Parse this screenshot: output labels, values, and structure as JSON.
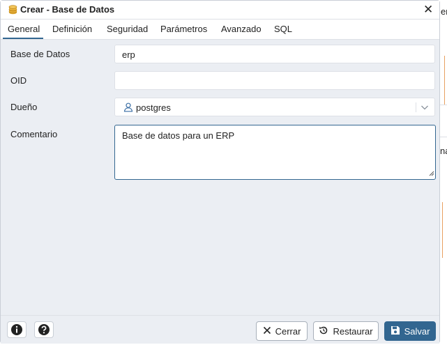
{
  "background": {
    "partial_text_top": "er",
    "partial_text_mid": "na"
  },
  "dialog": {
    "title": "Crear - Base de Datos",
    "icons": {
      "title": "database-icon",
      "close": "close-icon"
    }
  },
  "tabs": [
    {
      "label": "General",
      "active": true
    },
    {
      "label": "Definición"
    },
    {
      "label": "Seguridad"
    },
    {
      "label": "Parámetros"
    },
    {
      "label": "Avanzado"
    },
    {
      "label": "SQL"
    }
  ],
  "form": {
    "database": {
      "label": "Base de Datos",
      "value": "erp"
    },
    "oid": {
      "label": "OID",
      "value": ""
    },
    "owner": {
      "label": "Dueño",
      "value": "postgres",
      "icon": "user-icon"
    },
    "comment": {
      "label": "Comentario",
      "value": "Base de datos para un ERP"
    }
  },
  "footer": {
    "info_icon": "info-icon",
    "help_icon": "help-icon",
    "cancel_label": "Cerrar",
    "reset_label": "Restaurar",
    "save_label": "Salvar"
  },
  "colors": {
    "primary": "#326690",
    "dialog_bg": "#ebeef3",
    "border": "#dde0e6",
    "accent_orange": "#e8a060"
  }
}
